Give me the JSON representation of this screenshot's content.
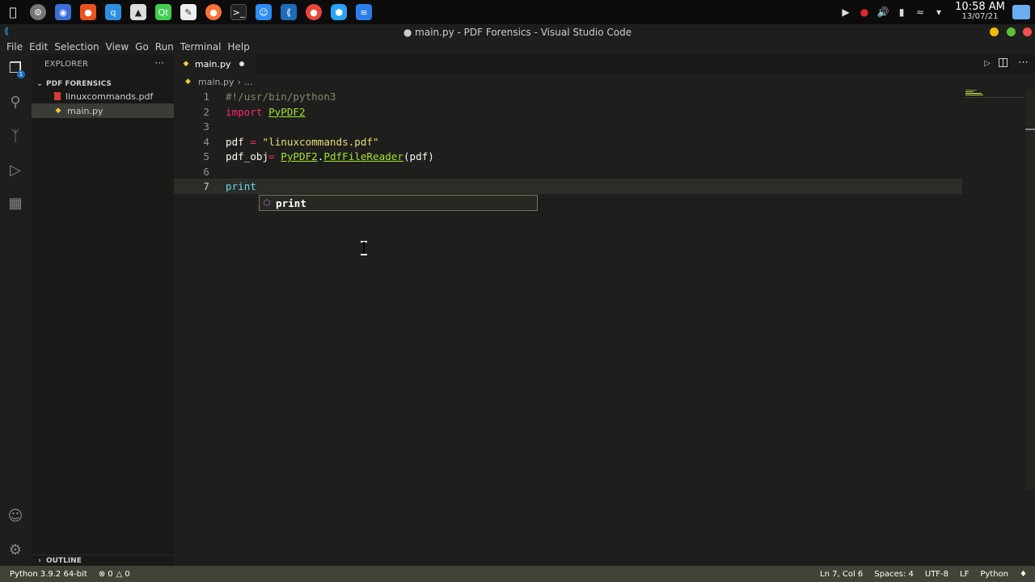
{
  "os": {
    "clock_time": "10:58 AM",
    "clock_date": "13/07/21"
  },
  "window": {
    "title": "● main.py - PDF Forensics - Visual Studio Code"
  },
  "menu": [
    "File",
    "Edit",
    "Selection",
    "View",
    "Go",
    "Run",
    "Terminal",
    "Help"
  ],
  "activity": {
    "explorer_badge": "1"
  },
  "sidebar": {
    "header": "EXPLORER",
    "more": "···",
    "folder": "PDF FORENSICS",
    "files": [
      {
        "name": "linuxcommands.pdf",
        "icon": "pdf-file-icon"
      },
      {
        "name": "main.py",
        "icon": "python-file-icon"
      }
    ],
    "outline": "OUTLINE"
  },
  "editor": {
    "tab": "main.py",
    "breadcrumb_file": "main.py",
    "breadcrumb_more": "...",
    "lines": [
      {
        "n": "1",
        "tokens": [
          {
            "t": "#!/usr/bin/python3",
            "c": "c-comment"
          }
        ]
      },
      {
        "n": "2",
        "tokens": [
          {
            "t": "import",
            "c": "c-kw"
          },
          {
            "t": " ",
            "c": "c-plain"
          },
          {
            "t": "PyPDF2",
            "c": "c-mod"
          }
        ]
      },
      {
        "n": "3",
        "tokens": []
      },
      {
        "n": "4",
        "tokens": [
          {
            "t": "pdf ",
            "c": "c-plain"
          },
          {
            "t": "=",
            "c": "c-kw"
          },
          {
            "t": " ",
            "c": "c-plain"
          },
          {
            "t": "\"linuxcommands.pdf\"",
            "c": "c-str"
          }
        ]
      },
      {
        "n": "5",
        "tokens": [
          {
            "t": "pdf_obj",
            "c": "c-plain"
          },
          {
            "t": "=",
            "c": "c-kw"
          },
          {
            "t": " ",
            "c": "c-plain"
          },
          {
            "t": "PyPDF2",
            "c": "c-mod"
          },
          {
            "t": ".",
            "c": "c-plain"
          },
          {
            "t": "PdfFileReader",
            "c": "c-fn"
          },
          {
            "t": "(pdf)",
            "c": "c-plain"
          }
        ]
      },
      {
        "n": "6",
        "tokens": []
      },
      {
        "n": "7",
        "tokens": [
          {
            "t": "print",
            "c": "c-print"
          }
        ]
      }
    ],
    "current_line": 7,
    "suggestion": "print"
  },
  "statusbar": {
    "interpreter": "Python 3.9.2 64-bit",
    "errors": "0",
    "warnings": "0",
    "position": "Ln 7, Col 6",
    "spaces": "Spaces: 4",
    "encoding": "UTF-8",
    "eol": "LF",
    "language": "Python"
  },
  "colors": {
    "accent": "#1f6fc5",
    "statusbar_bg": "#414339",
    "editor_bg": "#1e1f1c"
  }
}
